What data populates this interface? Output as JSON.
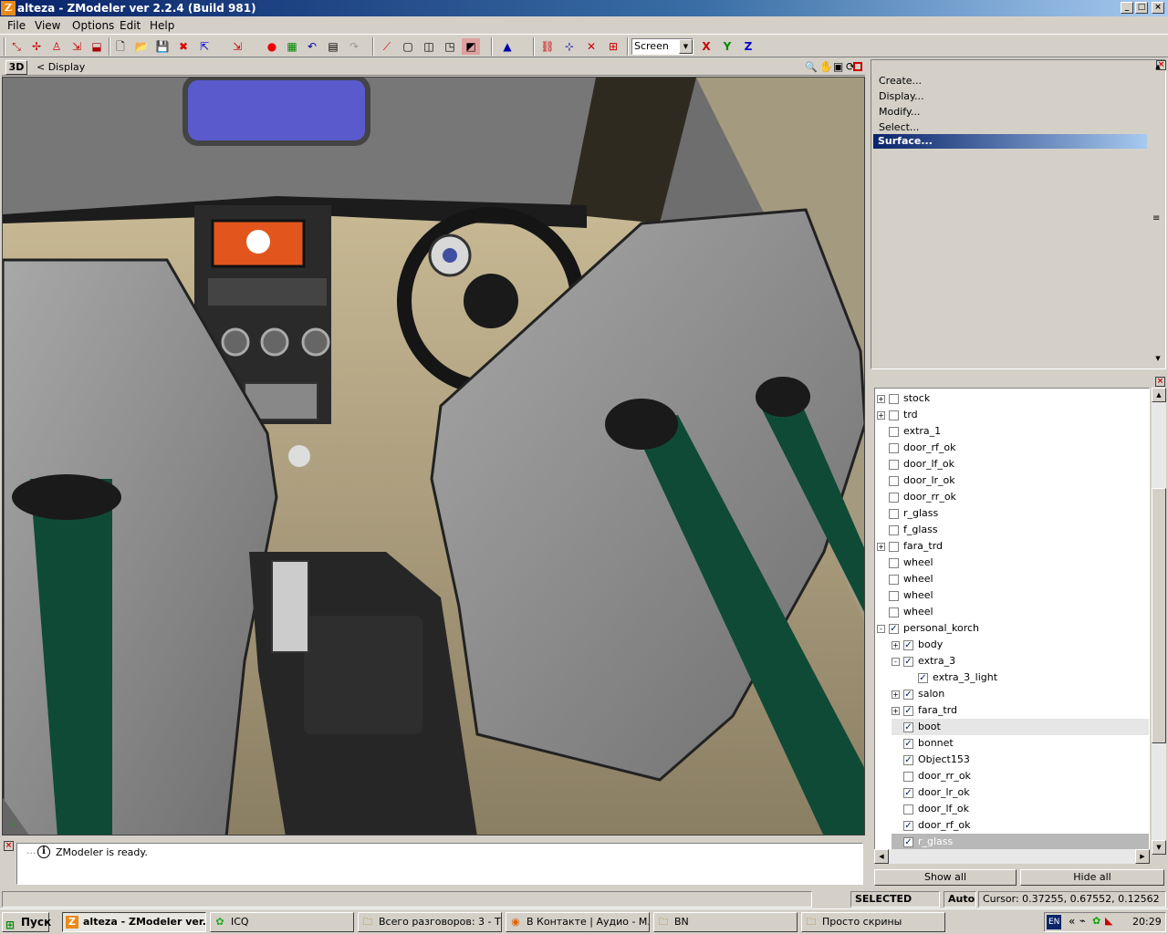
{
  "window": {
    "title": "alteza - ZModeler ver 2.2.4 (Build 981)",
    "app_icon": "Z"
  },
  "menu": [
    "File",
    "View",
    "Options",
    "Edit",
    "Help"
  ],
  "toolbar": {
    "view_select": "Screen",
    "axis_x": "X",
    "axis_y": "Y",
    "axis_z": "Z"
  },
  "viewport": {
    "mode_button": "3D",
    "breadcrumb": "<  Display"
  },
  "command_panel": {
    "items": [
      "Create...",
      "Display...",
      "Modify...",
      "Select..."
    ],
    "selected": "Surface..."
  },
  "tree": {
    "rows": [
      {
        "label": "stock",
        "expander": "+",
        "checked": false,
        "indent": 0
      },
      {
        "label": "trd",
        "expander": "+",
        "checked": false,
        "indent": 0
      },
      {
        "label": "extra_1",
        "expander": "",
        "checked": false,
        "indent": 0
      },
      {
        "label": "door_rf_ok",
        "expander": "",
        "checked": false,
        "indent": 0
      },
      {
        "label": "door_lf_ok",
        "expander": "",
        "checked": false,
        "indent": 0
      },
      {
        "label": "door_lr_ok",
        "expander": "",
        "checked": false,
        "indent": 0
      },
      {
        "label": "door_rr_ok",
        "expander": "",
        "checked": false,
        "indent": 0
      },
      {
        "label": "r_glass",
        "expander": "",
        "checked": false,
        "indent": 0
      },
      {
        "label": "f_glass",
        "expander": "",
        "checked": false,
        "indent": 0
      },
      {
        "label": "fara_trd",
        "expander": "+",
        "checked": false,
        "indent": 0
      },
      {
        "label": "wheel",
        "expander": "",
        "checked": false,
        "indent": 0
      },
      {
        "label": "wheel",
        "expander": "",
        "checked": false,
        "indent": 0
      },
      {
        "label": "wheel",
        "expander": "",
        "checked": false,
        "indent": 0
      },
      {
        "label": "wheel",
        "expander": "",
        "checked": false,
        "indent": 0
      },
      {
        "label": "personal_korch",
        "expander": "-",
        "checked": true,
        "indent": 0
      },
      {
        "label": "body",
        "expander": "+",
        "checked": true,
        "indent": 1
      },
      {
        "label": "extra_3",
        "expander": "-",
        "checked": true,
        "indent": 1
      },
      {
        "label": "extra_3_light",
        "expander": "",
        "checked": true,
        "indent": 2
      },
      {
        "label": "salon",
        "expander": "+",
        "checked": true,
        "indent": 1
      },
      {
        "label": "fara_trd",
        "expander": "+",
        "checked": true,
        "indent": 1
      },
      {
        "label": "boot",
        "expander": "",
        "checked": true,
        "indent": 1
      },
      {
        "label": "bonnet",
        "expander": "",
        "checked": true,
        "indent": 1
      },
      {
        "label": "Object153",
        "expander": "",
        "checked": true,
        "indent": 1
      },
      {
        "label": "door_rr_ok",
        "expander": "",
        "checked": false,
        "indent": 1
      },
      {
        "label": "door_lr_ok",
        "expander": "",
        "checked": true,
        "indent": 1
      },
      {
        "label": "door_lf_ok",
        "expander": "",
        "checked": false,
        "indent": 1
      },
      {
        "label": "door_rf_ok",
        "expander": "",
        "checked": true,
        "indent": 1
      },
      {
        "label": "r_glass",
        "expander": "",
        "checked": true,
        "indent": 1
      }
    ],
    "show_all": "Show all",
    "hide_all": "Hide all"
  },
  "log": {
    "message": "ZModeler is ready."
  },
  "status": {
    "mode": "SELECTED MODE",
    "auto": "Auto",
    "cursor": "Cursor: 0.37255, 0.67552, 0.12562"
  },
  "taskbar": {
    "start": "Пуск",
    "tasks": [
      "alteza - ZModeler ver...",
      "ICQ",
      "Всего разговоров: 3 - Т...",
      "В Контакте | Аудио - М...",
      "BN",
      "Просто скрины"
    ],
    "lang": "EN",
    "clock": "20:29"
  },
  "screen_display": {
    "text": ""
  }
}
